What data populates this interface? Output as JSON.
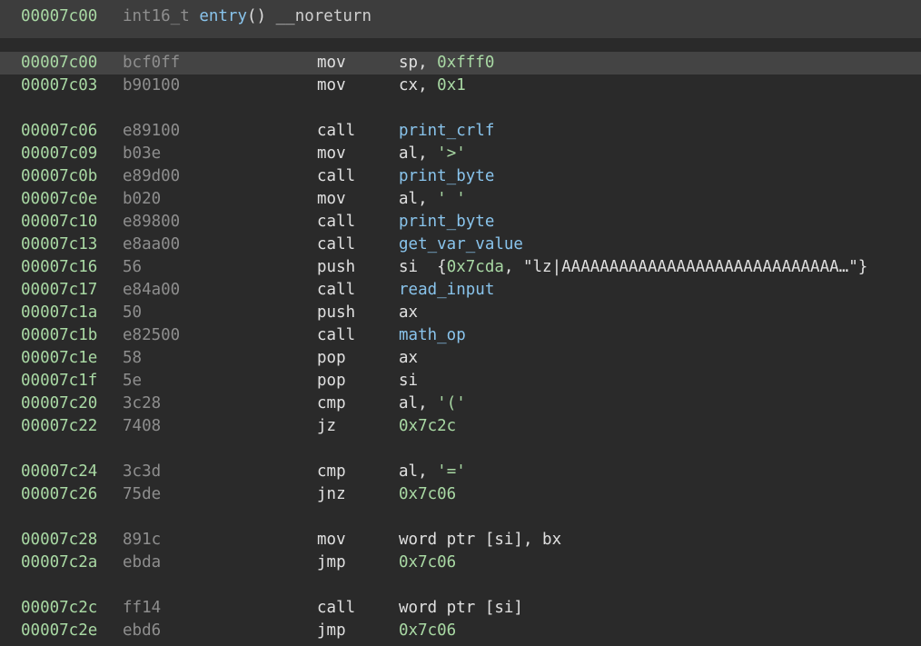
{
  "header": {
    "address": "00007c00",
    "return_type": "int16_t",
    "function_name": "entry",
    "parens": "()",
    "attribute": "__noreturn"
  },
  "colors": {
    "address": "#a9d9a4",
    "bytes": "#8e8e8e",
    "symbol": "#89c4ec",
    "text": "#e0e0e0",
    "header_bg": "#3d3d3d",
    "highlight_bg": "#444444",
    "background": "#2a2a2a"
  },
  "rows": [
    {
      "type": "insn",
      "addr": "00007c00",
      "bytes": "bcf0ff",
      "mnem": "mov",
      "ops": [
        {
          "t": "reg",
          "v": "sp, "
        },
        {
          "t": "num",
          "v": "0xfff0"
        }
      ],
      "highlight": true
    },
    {
      "type": "insn",
      "addr": "00007c03",
      "bytes": "b90100",
      "mnem": "mov",
      "ops": [
        {
          "t": "reg",
          "v": "cx, "
        },
        {
          "t": "num",
          "v": "0x1"
        }
      ]
    },
    {
      "type": "gap"
    },
    {
      "type": "insn",
      "addr": "00007c06",
      "bytes": "e89100",
      "mnem": "call",
      "ops": [
        {
          "t": "sym",
          "v": "print_crlf"
        }
      ]
    },
    {
      "type": "insn",
      "addr": "00007c09",
      "bytes": "b03e",
      "mnem": "mov",
      "ops": [
        {
          "t": "reg",
          "v": "al, "
        },
        {
          "t": "chr",
          "v": "'>'"
        }
      ]
    },
    {
      "type": "insn",
      "addr": "00007c0b",
      "bytes": "e89d00",
      "mnem": "call",
      "ops": [
        {
          "t": "sym",
          "v": "print_byte"
        }
      ]
    },
    {
      "type": "insn",
      "addr": "00007c0e",
      "bytes": "b020",
      "mnem": "mov",
      "ops": [
        {
          "t": "reg",
          "v": "al, "
        },
        {
          "t": "chr",
          "v": "' '"
        }
      ]
    },
    {
      "type": "insn",
      "addr": "00007c10",
      "bytes": "e89800",
      "mnem": "call",
      "ops": [
        {
          "t": "sym",
          "v": "print_byte"
        }
      ]
    },
    {
      "type": "insn",
      "addr": "00007c13",
      "bytes": "e8aa00",
      "mnem": "call",
      "ops": [
        {
          "t": "sym",
          "v": "get_var_value"
        }
      ]
    },
    {
      "type": "insn",
      "addr": "00007c16",
      "bytes": "56",
      "mnem": "push",
      "ops": [
        {
          "t": "reg",
          "v": "si  {"
        },
        {
          "t": "num",
          "v": "0x7cda"
        },
        {
          "t": "str",
          "v": ", \"lz|AAAAAAAAAAAAAAAAAAAAAAAAAAAAA…\"}"
        }
      ]
    },
    {
      "type": "insn",
      "addr": "00007c17",
      "bytes": "e84a00",
      "mnem": "call",
      "ops": [
        {
          "t": "sym",
          "v": "read_input"
        }
      ]
    },
    {
      "type": "insn",
      "addr": "00007c1a",
      "bytes": "50",
      "mnem": "push",
      "ops": [
        {
          "t": "reg",
          "v": "ax"
        }
      ]
    },
    {
      "type": "insn",
      "addr": "00007c1b",
      "bytes": "e82500",
      "mnem": "call",
      "ops": [
        {
          "t": "sym",
          "v": "math_op"
        }
      ]
    },
    {
      "type": "insn",
      "addr": "00007c1e",
      "bytes": "58",
      "mnem": "pop",
      "ops": [
        {
          "t": "reg",
          "v": "ax"
        }
      ]
    },
    {
      "type": "insn",
      "addr": "00007c1f",
      "bytes": "5e",
      "mnem": "pop",
      "ops": [
        {
          "t": "reg",
          "v": "si"
        }
      ]
    },
    {
      "type": "insn",
      "addr": "00007c20",
      "bytes": "3c28",
      "mnem": "cmp",
      "ops": [
        {
          "t": "reg",
          "v": "al, "
        },
        {
          "t": "chr",
          "v": "'('"
        }
      ]
    },
    {
      "type": "insn",
      "addr": "00007c22",
      "bytes": "7408",
      "mnem": "jz",
      "ops": [
        {
          "t": "num",
          "v": "0x7c2c"
        }
      ]
    },
    {
      "type": "gap"
    },
    {
      "type": "insn",
      "addr": "00007c24",
      "bytes": "3c3d",
      "mnem": "cmp",
      "ops": [
        {
          "t": "reg",
          "v": "al, "
        },
        {
          "t": "chr",
          "v": "'='"
        }
      ]
    },
    {
      "type": "insn",
      "addr": "00007c26",
      "bytes": "75de",
      "mnem": "jnz",
      "ops": [
        {
          "t": "num",
          "v": "0x7c06"
        }
      ]
    },
    {
      "type": "gap"
    },
    {
      "type": "insn",
      "addr": "00007c28",
      "bytes": "891c",
      "mnem": "mov",
      "ops": [
        {
          "t": "reg",
          "v": "word ptr [si], bx"
        }
      ]
    },
    {
      "type": "insn",
      "addr": "00007c2a",
      "bytes": "ebda",
      "mnem": "jmp",
      "ops": [
        {
          "t": "num",
          "v": "0x7c06"
        }
      ]
    },
    {
      "type": "gap"
    },
    {
      "type": "insn",
      "addr": "00007c2c",
      "bytes": "ff14",
      "mnem": "call",
      "ops": [
        {
          "t": "reg",
          "v": "word ptr [si]"
        }
      ]
    },
    {
      "type": "insn",
      "addr": "00007c2e",
      "bytes": "ebd6",
      "mnem": "jmp",
      "ops": [
        {
          "t": "num",
          "v": "0x7c06"
        }
      ]
    }
  ]
}
